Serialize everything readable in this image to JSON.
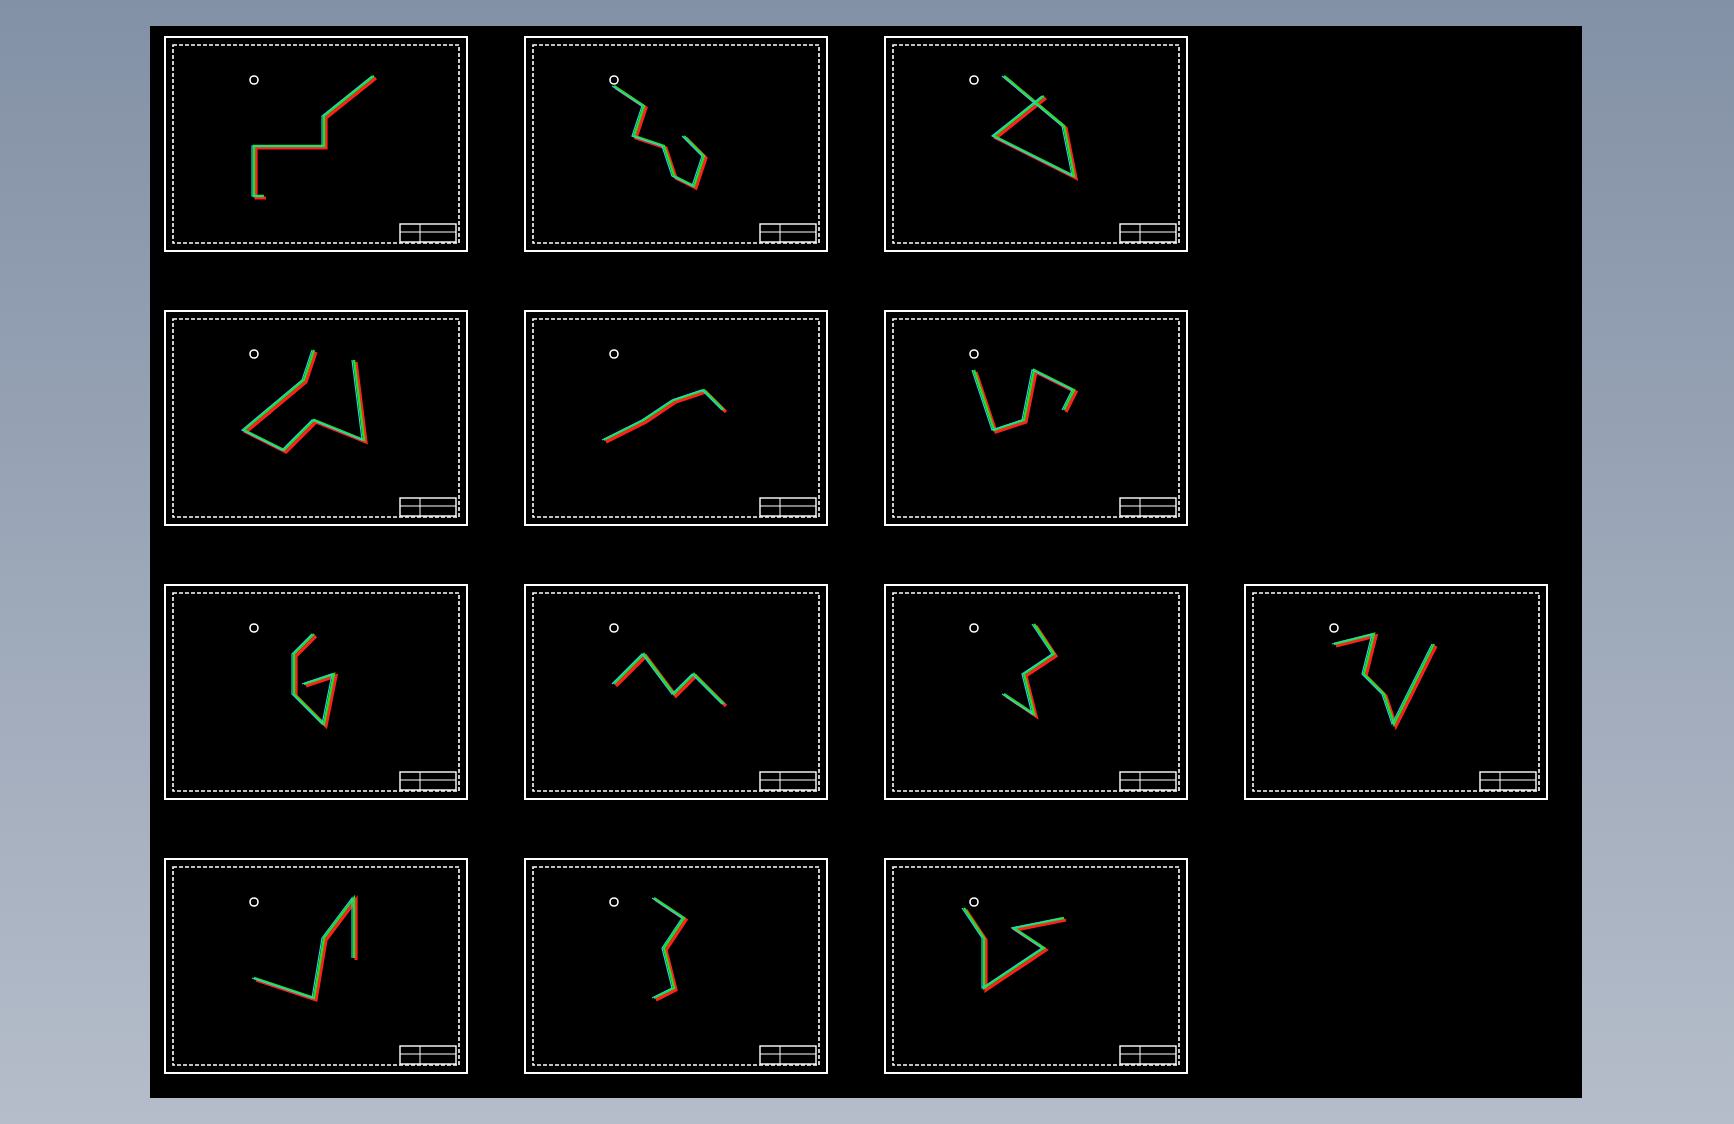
{
  "canvas": {
    "rows": [
      {
        "sheets": [
          {
            "kind": "drawing"
          },
          {
            "kind": "drawing"
          },
          {
            "kind": "drawing"
          }
        ]
      },
      {
        "sheets": [
          {
            "kind": "drawing"
          },
          {
            "kind": "drawing"
          },
          {
            "kind": "drawing"
          }
        ]
      },
      {
        "sheets": [
          {
            "kind": "drawing"
          },
          {
            "kind": "drawing"
          },
          {
            "kind": "drawing"
          },
          {
            "kind": "drawing"
          }
        ]
      },
      {
        "sheets": [
          {
            "kind": "drawing"
          },
          {
            "kind": "drawing"
          },
          {
            "kind": "drawing"
          }
        ]
      }
    ]
  }
}
